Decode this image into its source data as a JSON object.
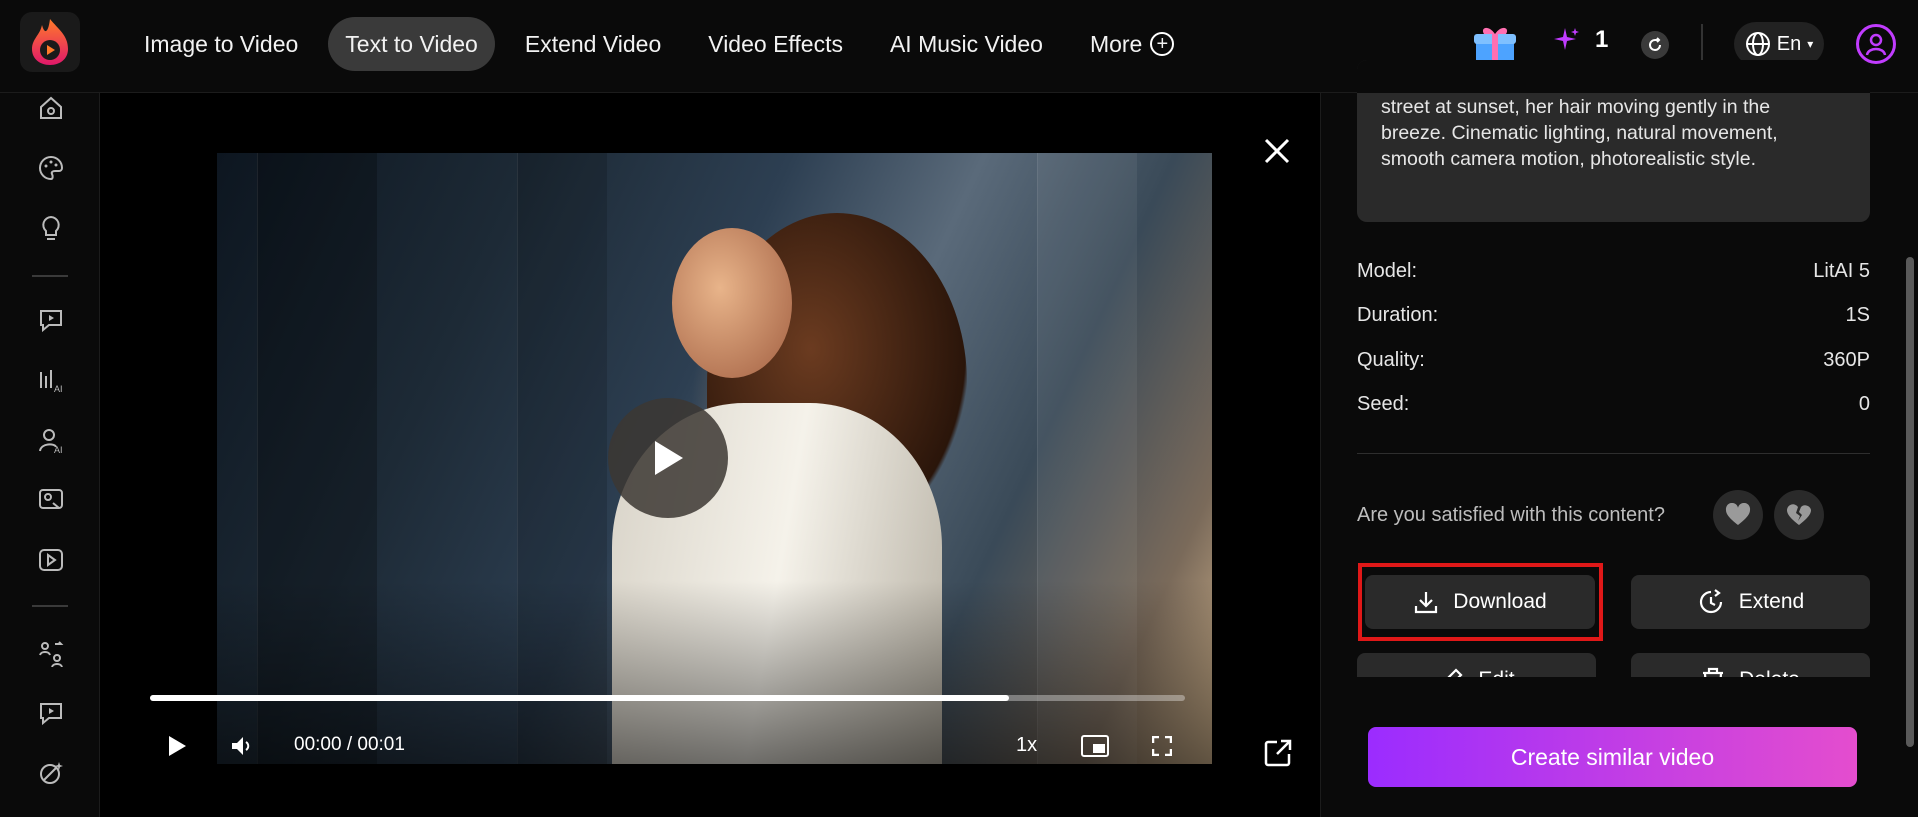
{
  "nav": {
    "items": [
      {
        "label": "Image to Video",
        "active": false
      },
      {
        "label": "Text to Video",
        "active": true
      },
      {
        "label": "Extend Video",
        "active": false
      },
      {
        "label": "Video Effects",
        "active": false
      },
      {
        "label": "AI Music Video",
        "active": false
      }
    ],
    "more_label": "More"
  },
  "header": {
    "credits": "1",
    "language": "En"
  },
  "sidebar": {
    "icons": [
      "home-icon",
      "palette-icon",
      "lightbulb-icon",
      "chat-video-icon",
      "ai-audio-icon",
      "ai-avatar-icon",
      "image-scan-icon",
      "video-play-icon",
      "face-swap-icon",
      "chat-video-icon-2",
      "magic-eraser-icon"
    ]
  },
  "player": {
    "time": "00:00 / 00:01",
    "speed": "1x",
    "progress_fraction": 0.83
  },
  "details": {
    "prompt_lines": [
      "street at sunset, her hair moving gently in the",
      "breeze. Cinematic lighting, natural movement,",
      "smooth camera motion, photorealistic style."
    ],
    "rows": [
      {
        "label": "Model:",
        "value": "LitAI 5"
      },
      {
        "label": "Duration:",
        "value": "1S"
      },
      {
        "label": "Quality:",
        "value": "360P"
      },
      {
        "label": "Seed:",
        "value": "0"
      }
    ],
    "satisfy_question": "Are you satisfied with this content?"
  },
  "actions": {
    "download": "Download",
    "extend": "Extend",
    "edit": "Edit",
    "delete": "Delete",
    "create_similar": "Create similar video"
  },
  "colors": {
    "accent_start": "#9b2cff",
    "accent_end": "#e44dce",
    "highlight": "#e01818"
  }
}
